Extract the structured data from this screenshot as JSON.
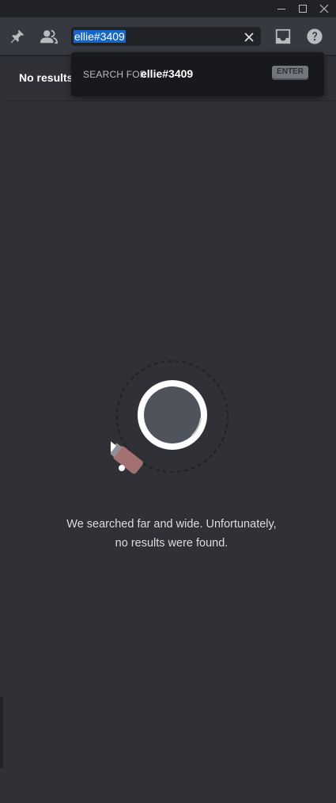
{
  "window": {
    "minimize_label": "minimize",
    "maximize_label": "maximize",
    "close_label": "close"
  },
  "toolbar": {
    "icons": [
      "pin-icon",
      "members-icon",
      "inbox-icon",
      "help-icon"
    ]
  },
  "search": {
    "value": "ellie#3409",
    "clear_icon": "close-icon"
  },
  "dropdown": {
    "search_for_label": "SEARCH FOR:",
    "search_for_value": "ellie#3409",
    "enter_label": "ENTER"
  },
  "results": {
    "title": "No results"
  },
  "empty_state": {
    "line1": "We searched far and wide. Unfortunately,",
    "line2": "no results were found."
  },
  "colors": {
    "background": "#2f3136",
    "toolbar": "#36393f",
    "selection": "#1566c6"
  }
}
